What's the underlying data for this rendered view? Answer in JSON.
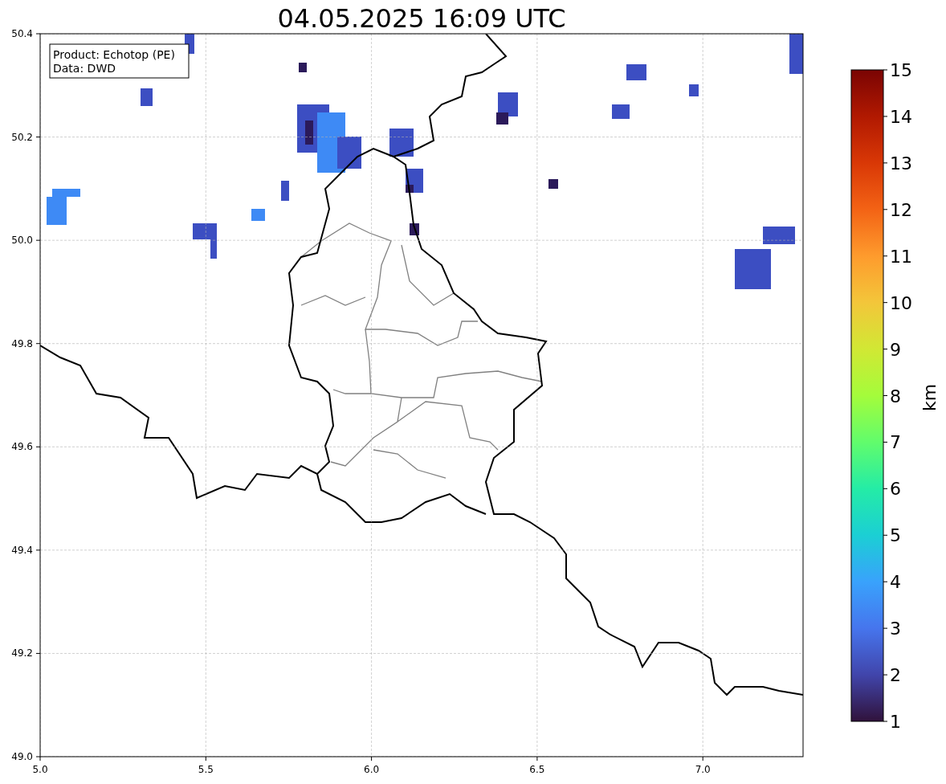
{
  "title": "04.05.2025 16:09 UTC",
  "info_box": [
    "Product: Echotop (PE)",
    "Data: DWD"
  ],
  "map": {
    "x_ticks": [
      "5.0",
      "5.5",
      "6.0",
      "6.5",
      "7.0"
    ],
    "y_ticks": [
      "50.4",
      "50.2",
      "50.0",
      "49.8",
      "49.6",
      "49.4",
      "49.2",
      "49.0"
    ]
  },
  "colorbar": {
    "label": "km",
    "ticks": [
      "15",
      "14",
      "13",
      "12",
      "11",
      "10",
      "9",
      "8",
      "7",
      "6",
      "5",
      "4",
      "3",
      "2",
      "1"
    ]
  }
}
